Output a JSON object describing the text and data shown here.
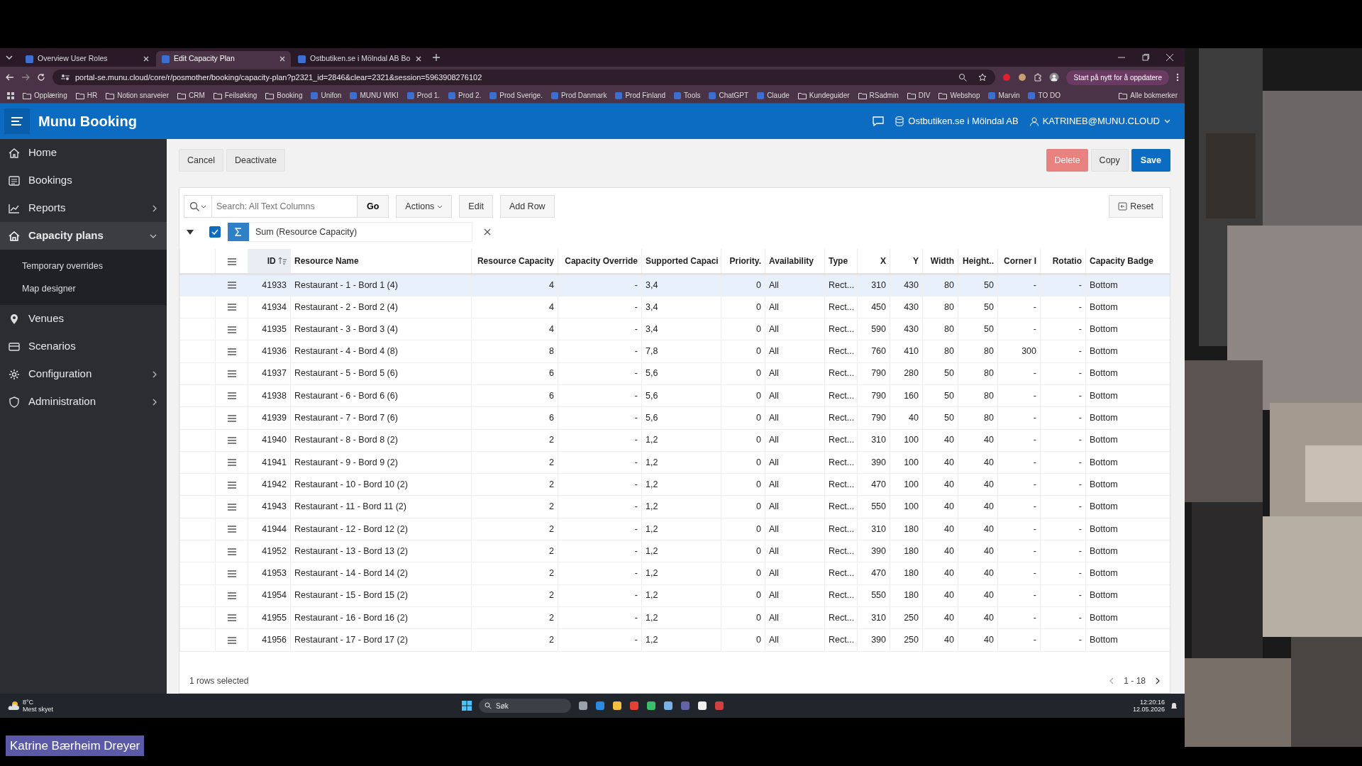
{
  "browser": {
    "tabs": [
      {
        "title": "Overview User Roles",
        "selected": false
      },
      {
        "title": "Edit Capacity Plan",
        "selected": true
      },
      {
        "title": "Ostbutiken.se i Mölndal AB Bo",
        "selected": false
      }
    ],
    "url": "portal-se.munu.cloud/core/r/posmother/booking/capacity-plan?p2321_id=2846&clear=2321&session=5963908276102",
    "update_button": "Start på nytt for å oppdatere",
    "bookmarks": [
      {
        "label": "Opplæring",
        "kind": "folder"
      },
      {
        "label": "HR",
        "kind": "folder"
      },
      {
        "label": "Notion snarveier",
        "kind": "folder"
      },
      {
        "label": "CRM",
        "kind": "folder"
      },
      {
        "label": "Feilsøking",
        "kind": "folder"
      },
      {
        "label": "Booking",
        "kind": "folder"
      },
      {
        "label": "Unifon",
        "kind": "site"
      },
      {
        "label": "MUNU WIKI",
        "kind": "site"
      },
      {
        "label": "Prod 1.",
        "kind": "site"
      },
      {
        "label": "Prod 2.",
        "kind": "site"
      },
      {
        "label": "Prod Sverige.",
        "kind": "site"
      },
      {
        "label": "Prod Danmark",
        "kind": "site"
      },
      {
        "label": "Prod Finland",
        "kind": "site"
      },
      {
        "label": "Tools",
        "kind": "site"
      },
      {
        "label": "ChatGPT",
        "kind": "site"
      },
      {
        "label": "Claude",
        "kind": "site"
      },
      {
        "label": "Kundeguider",
        "kind": "folder"
      },
      {
        "label": "RSadmin",
        "kind": "folder"
      },
      {
        "label": "DIV",
        "kind": "folder"
      },
      {
        "label": "Webshop",
        "kind": "folder"
      },
      {
        "label": "Marvin",
        "kind": "site"
      },
      {
        "label": "TO DO",
        "kind": "site"
      }
    ],
    "all_bookmarks": "Alle bokmerker"
  },
  "app": {
    "title": "Munu Booking",
    "company": "Ostbutiken.se i Mölndal AB",
    "user": "KATRINEB@MUNU.CLOUD"
  },
  "sidebar": {
    "items": [
      {
        "label": "Home",
        "kind": "home",
        "selected": false
      },
      {
        "label": "Bookings",
        "kind": "list",
        "selected": false
      },
      {
        "label": "Reports",
        "kind": "chart",
        "selected": false,
        "expanded": false
      },
      {
        "label": "Capacity plans",
        "kind": "house",
        "selected": true,
        "expanded": true,
        "children": [
          {
            "label": "Temporary overrides"
          },
          {
            "label": "Map designer"
          }
        ]
      },
      {
        "label": "Venues",
        "kind": "pin",
        "selected": false
      },
      {
        "label": "Scenarios",
        "kind": "box",
        "selected": false
      },
      {
        "label": "Configuration",
        "kind": "gear",
        "selected": false,
        "expanded": false
      },
      {
        "label": "Administration",
        "kind": "shield",
        "selected": false,
        "expanded": false
      }
    ]
  },
  "toolbar": {
    "left_buttons": [
      "Cancel",
      "Deactivate"
    ],
    "right_buttons": [
      {
        "label": "Delete",
        "kind": "danger"
      },
      {
        "label": "Copy",
        "kind": "plain"
      },
      {
        "label": "Save",
        "kind": "primary"
      }
    ]
  },
  "search": {
    "placeholder": "Search: All Text Columns",
    "go": "Go",
    "actions": "Actions",
    "edit": "Edit",
    "add_row": "Add Row",
    "reset": "Reset"
  },
  "filter": {
    "enabled": true,
    "label": "Sum (Resource Capacity)"
  },
  "table": {
    "columns": [
      {
        "label": "ID",
        "sorted": true
      },
      {
        "label": "Resource Name",
        "sorted": false
      },
      {
        "label": "Resource Capacity",
        "sorted": false
      },
      {
        "label": "Capacity Override",
        "sorted": false
      },
      {
        "label": "Supported Capaci",
        "sorted": false
      },
      {
        "label": "Priority.",
        "sorted": false
      },
      {
        "label": "Availability",
        "sorted": false
      },
      {
        "label": "Type",
        "sorted": false
      },
      {
        "label": "X",
        "sorted": false
      },
      {
        "label": "Y",
        "sorted": false
      },
      {
        "label": "Width",
        "sorted": false
      },
      {
        "label": "Height..",
        "sorted": false
      },
      {
        "label": "Corner I",
        "sorted": false
      },
      {
        "label": "Rotatio",
        "sorted": false
      },
      {
        "label": "Capacity Badge",
        "sorted": false
      }
    ],
    "rows": [
      {
        "selected": true,
        "cells": [
          "41933",
          "Restaurant - 1 - Bord 1 (4)",
          "4",
          "-",
          "3,4",
          "0",
          "All",
          "Rect...",
          "310",
          "430",
          "80",
          "50",
          "-",
          "-",
          "Bottom"
        ]
      },
      {
        "selected": false,
        "cells": [
          "41934",
          "Restaurant - 2 - Bord 2 (4)",
          "4",
          "-",
          "3,4",
          "0",
          "All",
          "Rect...",
          "450",
          "430",
          "80",
          "50",
          "-",
          "-",
          "Bottom"
        ]
      },
      {
        "selected": false,
        "cells": [
          "41935",
          "Restaurant - 3 - Bord 3 (4)",
          "4",
          "-",
          "3,4",
          "0",
          "All",
          "Rect...",
          "590",
          "430",
          "80",
          "50",
          "-",
          "-",
          "Bottom"
        ]
      },
      {
        "selected": false,
        "cells": [
          "41936",
          "Restaurant - 4 - Bord 4 (8)",
          "8",
          "-",
          "7,8",
          "0",
          "All",
          "Rect...",
          "760",
          "410",
          "80",
          "80",
          "300",
          "-",
          "Bottom"
        ]
      },
      {
        "selected": false,
        "cells": [
          "41937",
          "Restaurant - 5 - Bord 5 (6)",
          "6",
          "-",
          "5,6",
          "0",
          "All",
          "Rect...",
          "790",
          "280",
          "50",
          "80",
          "-",
          "-",
          "Bottom"
        ]
      },
      {
        "selected": false,
        "cells": [
          "41938",
          "Restaurant - 6 - Bord 6 (6)",
          "6",
          "-",
          "5,6",
          "0",
          "All",
          "Rect...",
          "790",
          "160",
          "50",
          "80",
          "-",
          "-",
          "Bottom"
        ]
      },
      {
        "selected": false,
        "cells": [
          "41939",
          "Restaurant - 7 - Bord 7 (6)",
          "6",
          "-",
          "5,6",
          "0",
          "All",
          "Rect...",
          "790",
          "40",
          "50",
          "80",
          "-",
          "-",
          "Bottom"
        ]
      },
      {
        "selected": false,
        "cells": [
          "41940",
          "Restaurant - 8 - Bord 8 (2)",
          "2",
          "-",
          "1,2",
          "0",
          "All",
          "Rect...",
          "310",
          "100",
          "40",
          "40",
          "-",
          "-",
          "Bottom"
        ]
      },
      {
        "selected": false,
        "cells": [
          "41941",
          "Restaurant - 9 - Bord 9 (2)",
          "2",
          "-",
          "1,2",
          "0",
          "All",
          "Rect...",
          "390",
          "100",
          "40",
          "40",
          "-",
          "-",
          "Bottom"
        ]
      },
      {
        "selected": false,
        "cells": [
          "41942",
          "Restaurant - 10 - Bord 10 (2)",
          "2",
          "-",
          "1,2",
          "0",
          "All",
          "Rect...",
          "470",
          "100",
          "40",
          "40",
          "-",
          "-",
          "Bottom"
        ]
      },
      {
        "selected": false,
        "cells": [
          "41943",
          "Restaurant - 11 - Bord 11 (2)",
          "2",
          "-",
          "1,2",
          "0",
          "All",
          "Rect...",
          "550",
          "100",
          "40",
          "40",
          "-",
          "-",
          "Bottom"
        ]
      },
      {
        "selected": false,
        "cells": [
          "41944",
          "Restaurant - 12 - Bord 12 (2)",
          "2",
          "-",
          "1,2",
          "0",
          "All",
          "Rect...",
          "310",
          "180",
          "40",
          "40",
          "-",
          "-",
          "Bottom"
        ]
      },
      {
        "selected": false,
        "cells": [
          "41952",
          "Restaurant - 13 - Bord 13 (2)",
          "2",
          "-",
          "1,2",
          "0",
          "All",
          "Rect...",
          "390",
          "180",
          "40",
          "40",
          "-",
          "-",
          "Bottom"
        ]
      },
      {
        "selected": false,
        "cells": [
          "41953",
          "Restaurant - 14 - Bord 14 (2)",
          "2",
          "-",
          "1,2",
          "0",
          "All",
          "Rect...",
          "470",
          "180",
          "40",
          "40",
          "-",
          "-",
          "Bottom"
        ]
      },
      {
        "selected": false,
        "cells": [
          "41954",
          "Restaurant - 15 - Bord 15 (2)",
          "2",
          "-",
          "1,2",
          "0",
          "All",
          "Rect...",
          "550",
          "180",
          "40",
          "40",
          "-",
          "-",
          "Bottom"
        ]
      },
      {
        "selected": false,
        "cells": [
          "41955",
          "Restaurant - 16 - Bord 16 (2)",
          "2",
          "-",
          "1,2",
          "0",
          "All",
          "Rect...",
          "310",
          "250",
          "40",
          "40",
          "-",
          "-",
          "Bottom"
        ]
      },
      {
        "selected": false,
        "cells": [
          "41956",
          "Restaurant - 17 - Bord 17 (2)",
          "2",
          "-",
          "1,2",
          "0",
          "All",
          "Rect...",
          "390",
          "250",
          "40",
          "40",
          "-",
          "-",
          "Bottom"
        ]
      }
    ]
  },
  "footer": {
    "selection": "1 rows selected",
    "range": "1 - 18"
  },
  "taskbar": {
    "temperature": "8°C",
    "weather": "Mest skyet",
    "search": "Søk",
    "time": "12:20:16",
    "date": "12.05.2026"
  },
  "presenter": "Katrine Bærheim Dreyer"
}
